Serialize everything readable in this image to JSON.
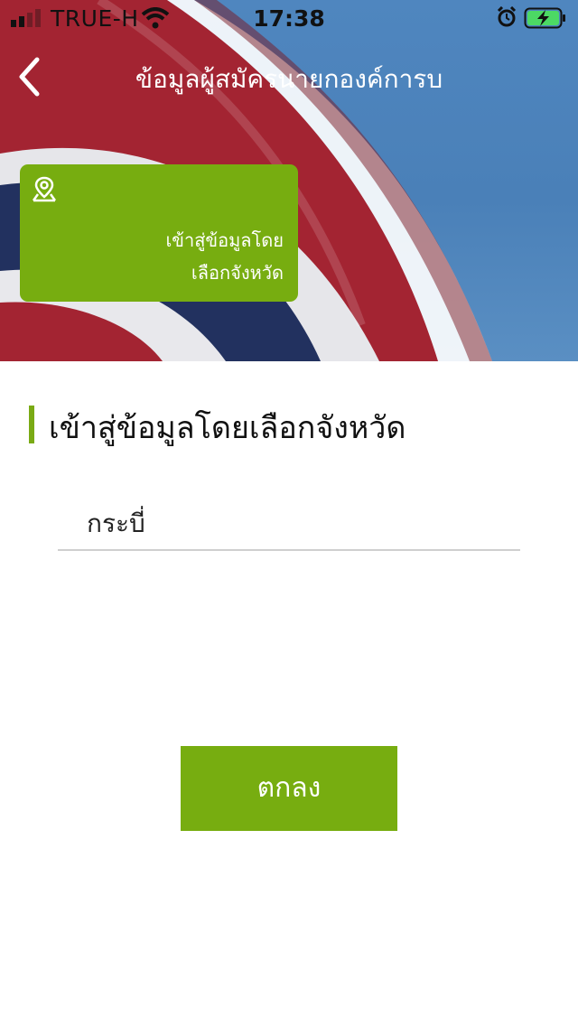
{
  "status_bar": {
    "carrier": "TRUE-H",
    "time": "17:38",
    "signal_icon": "signal-bars-icon",
    "wifi_icon": "wifi-icon",
    "alarm_icon": "alarm-icon",
    "battery_icon": "battery-charging-icon"
  },
  "nav": {
    "back_icon": "chevron-left-icon",
    "title": "ข้อมูลผู้สมัครนายกองค์การบ"
  },
  "tile": {
    "icon": "map-pin-icon",
    "line1": "เข้าสู่ข้อมูลโดย",
    "line2": "เลือกจังหวัด"
  },
  "section": {
    "title": "เข้าสู่ข้อมูลโดยเลือกจังหวัด"
  },
  "province_field": {
    "value": "กระบี่"
  },
  "confirm_button": {
    "label": "ตกลง"
  },
  "colors": {
    "accent_green": "#77ad10",
    "hero_blue": "#4a80b8",
    "flag_red": "#a32432",
    "flag_navy": "#1f2f5c"
  }
}
